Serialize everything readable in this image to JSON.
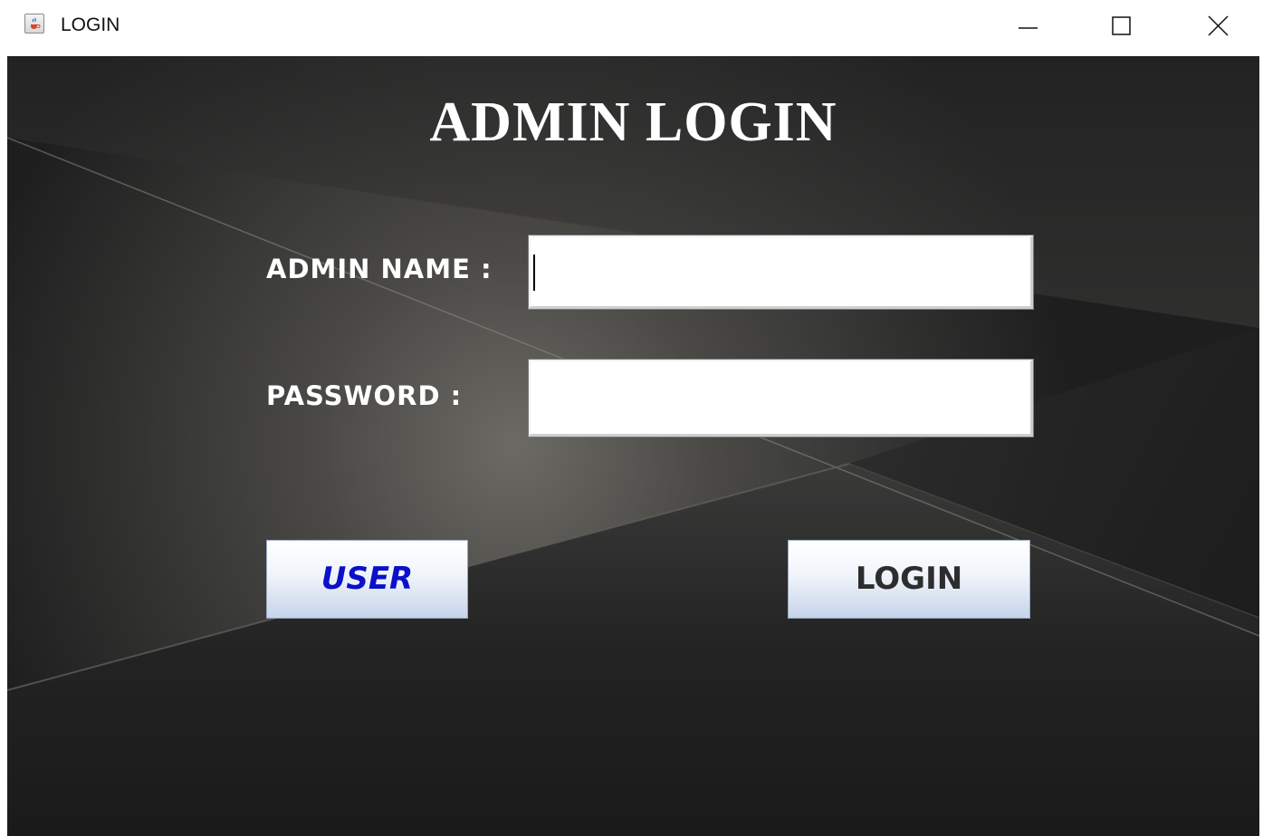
{
  "window": {
    "title": "LOGIN",
    "icon": "java-cup-icon",
    "controls": [
      "minimize-icon",
      "maximize-icon",
      "close-icon"
    ]
  },
  "form": {
    "heading": "ADMIN LOGIN",
    "admin_name_label": "ADMIN NAME :",
    "admin_name_value": "",
    "password_label": "PASSWORD :",
    "password_value": ""
  },
  "buttons": {
    "user_label": "USER",
    "login_label": "LOGIN"
  },
  "colors": {
    "background": "#2b2b2a",
    "heading_text": "#ffffff",
    "user_button_text": "#0b10c9",
    "login_button_text": "#2d2d2d"
  }
}
